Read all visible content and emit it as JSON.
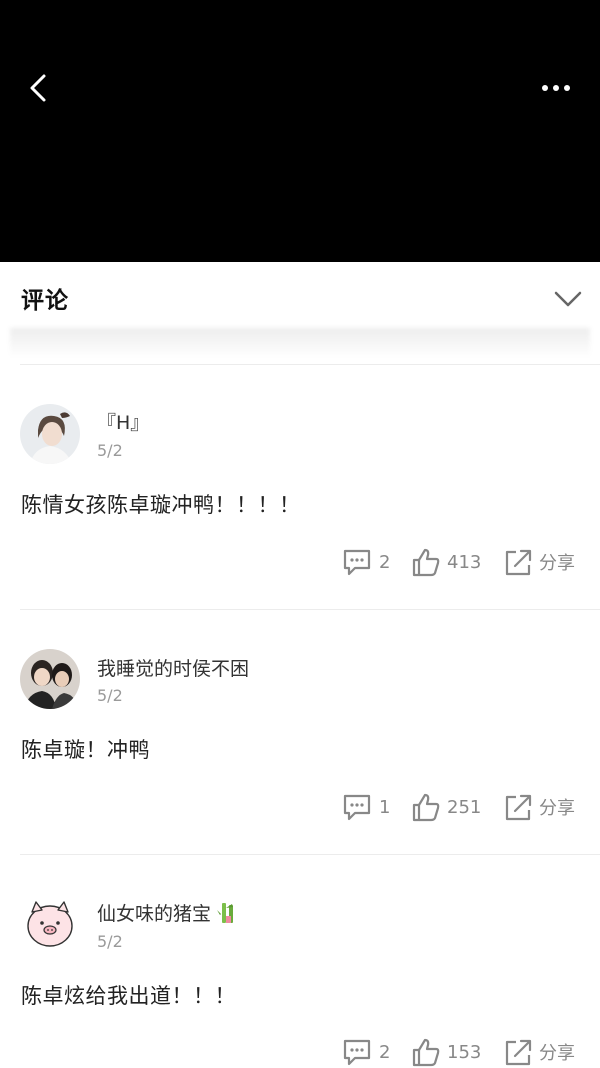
{
  "header": {
    "title": "评论"
  },
  "icons": {
    "back": "chevron-left-icon",
    "more": "more-horizontal-icon",
    "collapse": "chevron-down-icon",
    "comment": "comment-bubble-icon",
    "like": "thumbs-up-icon",
    "share": "share-arrow-icon"
  },
  "colors": {
    "topbar": "#000000",
    "action_gray": "#888888",
    "date_gray": "#9a9a9a"
  },
  "comments": [
    {
      "username": "『H』",
      "date": "5/2",
      "text": "陈情女孩陈卓璇冲鸭！！！！",
      "reply_count": "2",
      "like_count": "413",
      "share_label": "分享"
    },
    {
      "username": "我睡觉的时侯不困",
      "date": "5/2",
      "text": "陈卓璇！冲鸭",
      "reply_count": "1",
      "like_count": "251",
      "share_label": "分享"
    },
    {
      "username": "仙女味的猪宝",
      "date": "5/2",
      "text": "陈卓炫给我出道！！！",
      "reply_count": "2",
      "like_count": "153",
      "share_label": "分享"
    }
  ]
}
